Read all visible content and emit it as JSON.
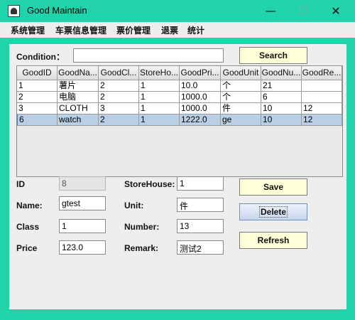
{
  "window": {
    "title": "Good Maintain",
    "minimize_glyph": "—",
    "maximize_glyph": "☐",
    "close_glyph": "✕"
  },
  "menu": [
    "系统管理",
    "车票信息管理",
    "票价管理",
    "退票",
    "统计"
  ],
  "search": {
    "label": "Condition：",
    "value": "",
    "button": "Search"
  },
  "table": {
    "columns": [
      "GoodID",
      "GoodNa...",
      "GoodCl...",
      "StoreHo...",
      "GoodPri...",
      "GoodUnit",
      "GoodNu...",
      "GoodRe..."
    ],
    "rows": [
      [
        "1",
        "薯片",
        "2",
        "1",
        "10.0",
        "个",
        "21",
        ""
      ],
      [
        "2",
        "电脑",
        "2",
        "1",
        "1000.0",
        "个",
        "6",
        ""
      ],
      [
        "3",
        "CLOTH",
        "3",
        "1",
        "1000.0",
        "件",
        "10",
        "12"
      ],
      [
        "6",
        "watch",
        "2",
        "1",
        "1222.0",
        "ge",
        "10",
        "12"
      ]
    ],
    "selected_row": 3
  },
  "form": {
    "id_label": "ID",
    "id_value": "8",
    "name_label": "Name:",
    "name_value": "gtest",
    "class_label": "Class",
    "class_value": "1",
    "price_label": "Price",
    "price_value": "123.0",
    "storehouse_label": "StoreHouse:",
    "storehouse_value": "1",
    "unit_label": "Unit:",
    "unit_value": "件",
    "number_label": "Number:",
    "number_value": "13",
    "remark_label": "Remark:",
    "remark_value": "测试2"
  },
  "buttons": {
    "save": "Save",
    "delete": "Delete",
    "refresh": "Refresh"
  },
  "colors": {
    "accent": "#20d3aa",
    "button_bg": "#ffffd8",
    "selection": "#b8cfe5"
  }
}
